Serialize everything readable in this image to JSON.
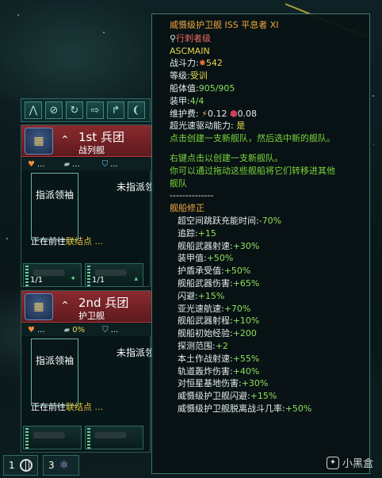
{
  "tooltip": {
    "title": "威慑级护卫舰 ISS 平息者 XI",
    "assassin_class": "行刺者级",
    "design": "ASCMAIN",
    "power_label": "战斗力:",
    "power_value": "542",
    "level_label": "等级:",
    "level_value": "受训",
    "hull_label": "船体值:",
    "hull_value": "905/905",
    "armor_label": "装甲:",
    "armor_value": "4/4",
    "upkeep_label": "维护费:",
    "upkeep_energy": "0.12",
    "upkeep_alloys": "0.08",
    "ftl_label": "超光速驱动能力:",
    "ftl_value": "是",
    "click_hint": "点击创建一支新舰队，然后选中新的舰队。",
    "right_click_hint": "右键点击以创建一支新舰队。",
    "drag_hint_1": "你可以通过拖动这些舰船将它们转移进其他",
    "drag_hint_2": "舰队",
    "divider": "--------------",
    "modifiers_title": "舰船修正",
    "modifiers": [
      {
        "label": "超空间跳跃充能时间:",
        "value": "-70%"
      },
      {
        "label": "追踪:",
        "value": "+15"
      },
      {
        "label": "舰船武器射速:",
        "value": "+30%"
      },
      {
        "label": "装甲值:",
        "value": "+50%"
      },
      {
        "label": "护盾承受值:",
        "value": "+50%"
      },
      {
        "label": "舰船武器伤害:",
        "value": "+65%"
      },
      {
        "label": "闪避:",
        "value": "+15%"
      },
      {
        "label": "亚光速航速:",
        "value": "+70%"
      },
      {
        "label": "舰船武器射程:",
        "value": "+10%"
      },
      {
        "label": "舰船初始经验:",
        "value": "+200"
      },
      {
        "label": "探测范围:",
        "value": "+2"
      },
      {
        "label": "本土作战射速:",
        "value": "+55%"
      },
      {
        "label": "轨道轰炸伤害:",
        "value": "+40%"
      },
      {
        "label": "对恒星基地伤害:",
        "value": "+30%"
      },
      {
        "label": "威慑级护卫舰闪避:",
        "value": "+15%"
      },
      {
        "label": "威慑级护卫舰脱离战斗几率:",
        "value": "+50%"
      }
    ]
  },
  "fleets": [
    {
      "name": "1st 兵团",
      "class": "战列舰",
      "stat_a": "...",
      "stat_b": "...",
      "stat_c": "...",
      "leader_label": "指派领袖",
      "unassigned": "未指派领",
      "dest_prefix": "正在前往",
      "dest_target": "联结点 ...",
      "ships": [
        {
          "count": "1/1"
        },
        {
          "count": "1/1"
        }
      ]
    },
    {
      "name": "2nd 兵团",
      "class": "护卫舰",
      "stat_a": "...",
      "stat_b": "0%",
      "stat_c": "...",
      "leader_label": "指派领袖",
      "unassigned": "未指派领",
      "dest_prefix": "正在前往",
      "dest_target": "联结点 ...",
      "ships": []
    }
  ],
  "bottom_tabs": [
    {
      "count": "1",
      "icon": "globe-icon"
    },
    {
      "count": "3",
      "icon": "atom-icon"
    }
  ],
  "watermark": "小黑盒",
  "colors": {
    "accent": "#3d7a74",
    "header_red": "#8a2a2e",
    "highlight_yellow": "#e4c03a",
    "value_green": "#8fe05a"
  }
}
